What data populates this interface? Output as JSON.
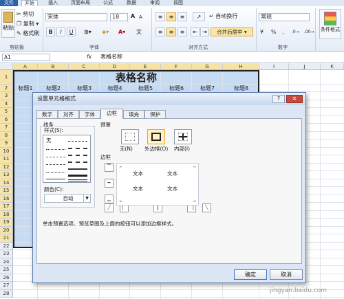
{
  "ribbon_tabs": {
    "file": "文件",
    "home": "开始",
    "insert": "插入",
    "layout": "页面布局",
    "formulas": "公式",
    "data": "数据",
    "review": "审阅",
    "view": "视图"
  },
  "clipboard": {
    "paste": "粘贴",
    "cut": "剪切",
    "copy": "复制 ▾",
    "painter": "格式刷",
    "group": "剪贴板"
  },
  "font": {
    "name": "宋体",
    "size": "18",
    "bold": "B",
    "italic": "I",
    "underline": "U",
    "group": "字体",
    "grow": "A",
    "shrink": "A",
    "wen": "文"
  },
  "alignment": {
    "wrap": "自动换行",
    "merge": "合并后居中 ▾",
    "group": "对齐方式"
  },
  "number": {
    "format": "常规",
    "percent": "%",
    "comma": ",",
    "group": "数字",
    "currency": "¥"
  },
  "styles": {
    "conditional": "条件格式",
    "group": ""
  },
  "formula_bar": {
    "name_box": "A1",
    "fx": "fx",
    "content": "表格名称"
  },
  "columns": [
    "A",
    "B",
    "C",
    "D",
    "E",
    "F",
    "G",
    "H",
    "I",
    "J",
    "K"
  ],
  "rows": [
    "1",
    "2",
    "3",
    "4",
    "5",
    "6",
    "7",
    "8",
    "9",
    "10",
    "11",
    "12",
    "13",
    "14",
    "15",
    "16",
    "17",
    "18",
    "19",
    "20",
    "21",
    "22",
    "23",
    "24",
    "25",
    "26",
    "27",
    "28"
  ],
  "sheet": {
    "title": "表格名称",
    "headers": [
      "标题1",
      "标题2",
      "标题3",
      "标题4",
      "标题5",
      "标题6",
      "标题7",
      "标题8"
    ]
  },
  "dialog": {
    "title": "设置单元格格式",
    "help": "?",
    "close": "✕",
    "tabs": [
      "数字",
      "对齐",
      "字体",
      "边框",
      "填充",
      "保护"
    ],
    "line_group": "线条",
    "style_label": "样式(S):",
    "none_label": "无",
    "color_label": "颜色(C):",
    "color_value": "自动",
    "presets_label": "预置",
    "preset_none": "无(N)",
    "preset_outline": "外边框(O)",
    "preset_inside": "内部(I)",
    "border_label": "边框",
    "preview_text": [
      "文本",
      "文本",
      "文本",
      "文本"
    ],
    "hint": "单击预置选项、预览草图及上面的按钮可以添加边框样式。",
    "ok": "确定",
    "cancel": "取消"
  },
  "watermark": "jingyan.baidu.com",
  "colors": {
    "selection": "#c7dbf3",
    "file_tab": "#2b62a8",
    "dialog_bg": "#dce6f4"
  }
}
